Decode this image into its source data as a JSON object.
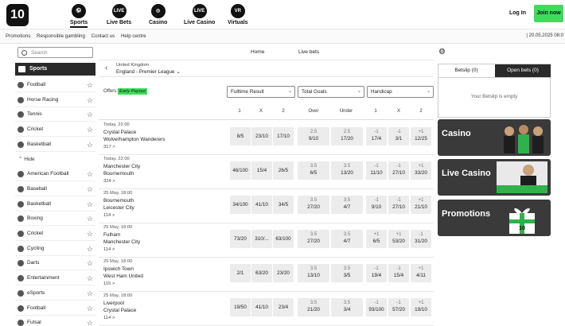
{
  "header": {
    "logo": "10",
    "nav": [
      {
        "label": "Sports",
        "icon": "soccer-ball-icon",
        "glyph": "⚽"
      },
      {
        "label": "Live Bets",
        "icon": "live-icon",
        "glyph": "LIVE"
      },
      {
        "label": "Casino",
        "icon": "casino-chip-icon",
        "glyph": "◎"
      },
      {
        "label": "Live Casino",
        "icon": "live-casino-icon",
        "glyph": "LIVE"
      },
      {
        "label": "Virtuals",
        "icon": "virtuals-icon",
        "glyph": "VR"
      }
    ],
    "login": "Log In",
    "join": "Join now"
  },
  "subbar": {
    "links": [
      "Promotions",
      "Responsible gambling",
      "Contact us",
      "Help centre"
    ],
    "datetime": "| 20.05.2025 08:0"
  },
  "sidebar": {
    "search_placeholder": "Search",
    "sports_label": "Sports",
    "hide_label": "⌃ Hide",
    "items": [
      "Football",
      "Horse Racing",
      "Tennis",
      "Cricket",
      "Basketball",
      "American Football",
      "Baseball",
      "Basketball",
      "Boxing",
      "Cricket",
      "Cycling",
      "Darts",
      "Entertainment",
      "eSports",
      "Football",
      "Futsal"
    ]
  },
  "main": {
    "tabs": [
      "Home",
      "Live bets"
    ],
    "breadcrumb": {
      "country": "United Kingdom",
      "league": "England - Premier League ⌄"
    },
    "offers_label": "Offers:",
    "early_payout": "Early Payout",
    "dropdowns": [
      "Fulltime Result",
      "Total Goals",
      "Handicap"
    ],
    "col_headers": [
      "1",
      "X",
      "2",
      "Over",
      "Under",
      "1",
      "X",
      "2"
    ],
    "matches": [
      {
        "time": "Today, 22:00",
        "home": "Crystal Palace",
        "away": "Wolverhampton Wanderers",
        "more": "317 >",
        "result": [
          "8/5",
          "23/10",
          "17/10"
        ],
        "over": {
          "line": "2.5",
          "price": "9/10"
        },
        "under": {
          "line": "2.5",
          "price": "17/20"
        },
        "hcp": [
          {
            "line": "-1",
            "price": "17/4"
          },
          {
            "line": "-1",
            "price": "3/1"
          },
          {
            "line": "+1",
            "price": "12/25"
          }
        ]
      },
      {
        "time": "Today, 22:00",
        "home": "Manchester City",
        "away": "Bournemouth",
        "more": "324 >",
        "result": [
          "46/100",
          "15/4",
          "26/5"
        ],
        "over": {
          "line": "3.5",
          "price": "6/5"
        },
        "under": {
          "line": "3.5",
          "price": "13/20"
        },
        "hcp": [
          {
            "line": "-1",
            "price": "11/10"
          },
          {
            "line": "-1",
            "price": "27/10"
          },
          {
            "line": "+1",
            "price": "33/20"
          }
        ]
      },
      {
        "time": "25 May, 18:00",
        "home": "Bournemouth",
        "away": "Leicester City",
        "more": "114 >",
        "result": [
          "34/100",
          "41/10",
          "34/5"
        ],
        "over": {
          "line": "3.5",
          "price": "27/20"
        },
        "under": {
          "line": "3.5",
          "price": "4/7"
        },
        "hcp": [
          {
            "line": "-1",
            "price": "9/10"
          },
          {
            "line": "-1",
            "price": "27/10"
          },
          {
            "line": "+1",
            "price": "21/10"
          }
        ]
      },
      {
        "time": "25 May, 18:00",
        "home": "Fulham",
        "away": "Manchester City",
        "more": "114 >",
        "result": [
          "73/20",
          "310/...",
          "63/100"
        ],
        "over": {
          "line": "3.5",
          "price": "27/20"
        },
        "under": {
          "line": "3.5",
          "price": "4/7"
        },
        "hcp": [
          {
            "line": "+1",
            "price": "6/5"
          },
          {
            "line": "+1",
            "price": "53/20"
          },
          {
            "line": "-1",
            "price": "31/20"
          }
        ]
      },
      {
        "time": "25 May, 18:00",
        "home": "Ipswich Town",
        "away": "West Ham United",
        "more": "115 >",
        "result": [
          "2/1",
          "63/20",
          "23/20"
        ],
        "over": {
          "line": "3.5",
          "price": "13/10"
        },
        "under": {
          "line": "3.5",
          "price": "3/5"
        },
        "hcp": [
          {
            "line": "-1",
            "price": "19/4"
          },
          {
            "line": "-1",
            "price": "15/4"
          },
          {
            "line": "+1",
            "price": "4/11"
          }
        ]
      },
      {
        "time": "25 May, 18:00",
        "home": "Liverpool",
        "away": "Crystal Palace",
        "more": "114 >",
        "result": [
          "19/50",
          "41/10",
          "23/4"
        ],
        "over": {
          "line": "3.5",
          "price": "21/20"
        },
        "under": {
          "line": "3.5",
          "price": "3/4"
        },
        "hcp": [
          {
            "line": "-1",
            "price": "93/100"
          },
          {
            "line": "-1",
            "price": "57/20"
          },
          {
            "line": "+1",
            "price": "19/10"
          }
        ]
      }
    ]
  },
  "betslip": {
    "tab_betslip": "Betslip (0)",
    "tab_open": "Open bets (0)",
    "empty": "Your Betslip is empty"
  },
  "promos": [
    {
      "title": "Casino"
    },
    {
      "title": "Live Casino"
    },
    {
      "title": "Promotions"
    }
  ],
  "colors": {
    "accent": "#3ddc5a",
    "dark": "#2a2a2a",
    "promo_bg": "#3a3a3a"
  }
}
